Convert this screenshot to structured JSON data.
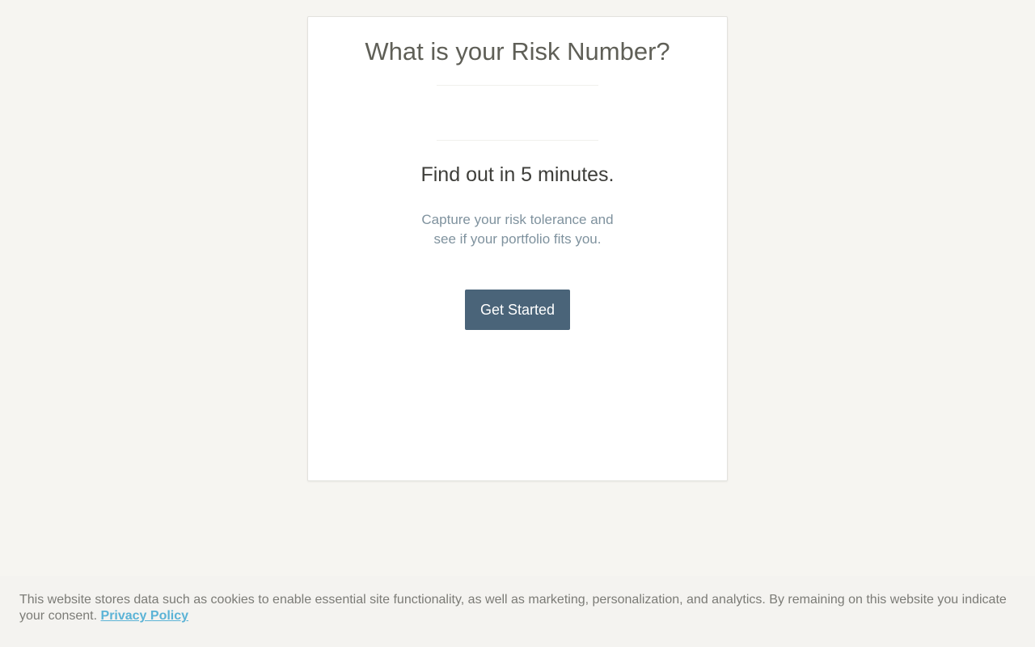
{
  "card": {
    "title": "What is your Risk Number?",
    "subtitle": "Find out in 5 minutes.",
    "description_line1": "Capture your risk tolerance and",
    "description_line2": "see if your portfolio fits you.",
    "cta_label": "Get Started"
  },
  "consent_banner": {
    "text": "This website stores data such as cookies to enable essential site functionality, as well as marketing, personalization, and analytics. By remaining on this website you indicate your consent.",
    "link_label": "Privacy Policy"
  },
  "colors": {
    "page_background": "#f6f5f1",
    "card_background": "#ffffff",
    "button_background": "#4a6479",
    "link": "#5bb3d6"
  }
}
